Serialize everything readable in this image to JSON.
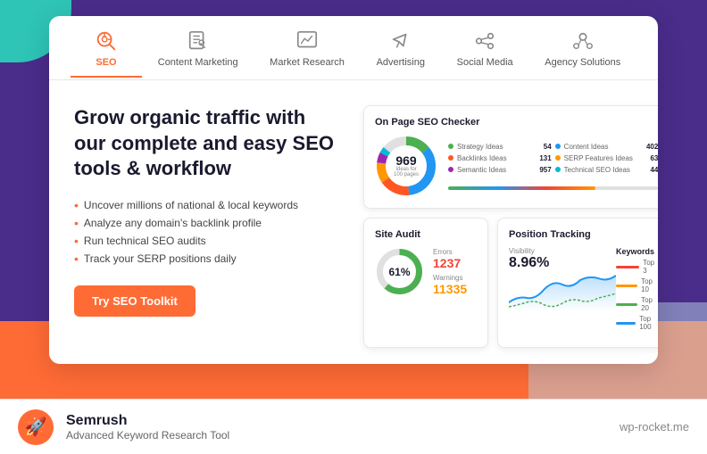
{
  "background": {
    "accent_color": "#ff6b35",
    "purple_bg": "#4a2c8a",
    "teal_blob": "#2ec4b6"
  },
  "nav": {
    "tabs": [
      {
        "id": "seo",
        "label": "SEO",
        "active": true
      },
      {
        "id": "content",
        "label": "Content Marketing",
        "active": false
      },
      {
        "id": "market",
        "label": "Market Research",
        "active": false
      },
      {
        "id": "advertising",
        "label": "Advertising",
        "active": false
      },
      {
        "id": "social",
        "label": "Social Media",
        "active": false
      },
      {
        "id": "agency",
        "label": "Agency Solutions",
        "active": false
      }
    ]
  },
  "hero": {
    "headline": "Grow organic traffic with our complete and easy SEO tools & workflow",
    "bullets": [
      "Uncover millions of national & local keywords",
      "Analyze any domain's backlink profile",
      "Run technical SEO audits",
      "Track your SERP positions daily"
    ],
    "cta_label": "Try SEO Toolkit"
  },
  "seo_checker": {
    "title": "On Page SEO Checker",
    "donut_value": "969",
    "donut_sub": "Ideas for\n100 pages",
    "stats": [
      {
        "label": "Strategy Ideas",
        "value": "54",
        "color": "#4CAF50"
      },
      {
        "label": "Content Ideas",
        "value": "402",
        "color": "#2196F3"
      },
      {
        "label": "Backlinks Ideas",
        "value": "131",
        "color": "#FF5722"
      },
      {
        "label": "SERP Features Ideas",
        "value": "63",
        "color": "#FF9800"
      },
      {
        "label": "Semantic Ideas",
        "value": "957",
        "color": "#9C27B0"
      },
      {
        "label": "Technical SEO Ideas",
        "value": "44",
        "color": "#00BCD4"
      }
    ],
    "progress": 70
  },
  "site_audit": {
    "title": "Site Audit",
    "score_pct": "61%",
    "score_value": 61,
    "errors_label": "Errors",
    "errors_value": "1237",
    "warnings_label": "Warnings",
    "warnings_value": "11335"
  },
  "position_tracking": {
    "title": "Position Tracking",
    "visibility_label": "Visibility",
    "visibility_value": "8.96%",
    "keywords_title": "Keywords",
    "keywords": [
      {
        "label": "Top 3",
        "color": "#f44336"
      },
      {
        "label": "Top 10",
        "color": "#ff9800"
      },
      {
        "label": "Top 20",
        "color": "#4CAF50"
      },
      {
        "label": "Top 100",
        "color": "#2196F3"
      }
    ]
  },
  "footer": {
    "title": "Semrush",
    "subtitle": "Advanced Keyword Research Tool",
    "url": "wp-rocket.me"
  }
}
